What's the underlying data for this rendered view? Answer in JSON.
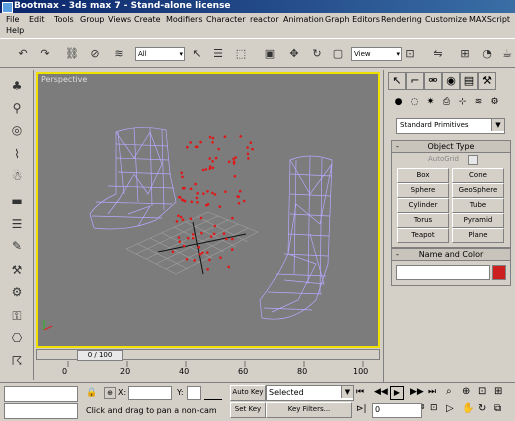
{
  "window": {
    "title": "Bootmax - 3ds max 7 - Stand-alone license"
  },
  "menu": [
    "File",
    "Edit",
    "Tools",
    "Group",
    "Views",
    "Create",
    "Modifiers",
    "Character",
    "reactor",
    "Animation",
    "Graph Editors",
    "Rendering",
    "Customize",
    "MAXScript",
    "Help"
  ],
  "toolbar": {
    "selection_filter": "All",
    "ref_coord": "View",
    "icons": [
      "undo-icon",
      "redo-icon",
      "link-icon",
      "unlink-icon",
      "bind-space-warp-icon",
      "select-icon",
      "select-by-name-icon",
      "rect-region-icon",
      "window-crossing-icon",
      "move-icon",
      "rotate-icon",
      "scale-icon",
      "pivot-icon",
      "mirror-icon",
      "align-icon",
      "curve-editor-icon",
      "material-editor-icon",
      "render-icon"
    ]
  },
  "viewport": {
    "label": "Perspective"
  },
  "time_slider": {
    "thumb": "0 / 100",
    "ticks": [
      "0",
      "20",
      "40",
      "60",
      "80",
      "100"
    ]
  },
  "command_panel": {
    "category": "Standard Primitives",
    "object_type": {
      "title": "Object Type",
      "autogrid": "AutoGrid",
      "buttons": [
        "Box",
        "Cone",
        "Sphere",
        "GeoSphere",
        "Cylinder",
        "Tube",
        "Torus",
        "Pyramid",
        "Teapot",
        "Plane"
      ]
    },
    "name_color": {
      "title": "Name and Color",
      "color": "#cc2020"
    }
  },
  "status": {
    "prompt": "Click and drag to pan a non-cam",
    "x_label": "X:",
    "y_label": "Y:",
    "auto_key": "Auto Key",
    "selected": "Selected",
    "set_key": "Set Key",
    "key_filters": "Key Filters...",
    "frame": "0"
  },
  "colors": {
    "wire": "#b8a8ff",
    "particles": "#e01818",
    "viewport_border": "#f0e000",
    "grid": "#a0a0a0"
  }
}
